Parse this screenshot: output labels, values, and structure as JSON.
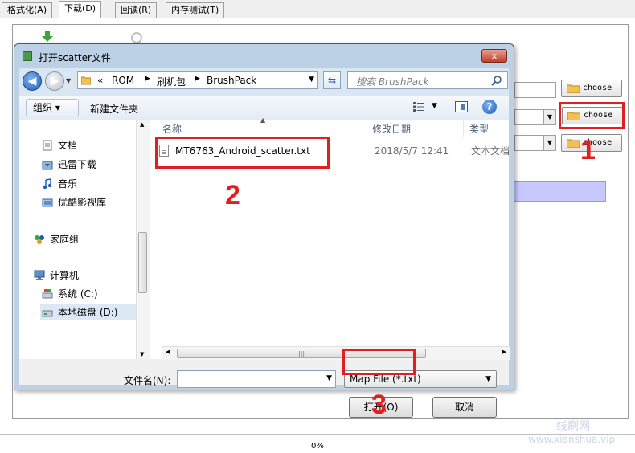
{
  "app": {
    "tabs": [
      {
        "label": "格式化(A)"
      },
      {
        "label": "下载(D)"
      },
      {
        "label": "回读(R)"
      },
      {
        "label": "内存测试(T)"
      }
    ],
    "choose_labels": [
      "choose",
      "choose",
      "choose"
    ],
    "progress_text": "0%",
    "watermark_cn": "线刷网",
    "watermark_url": "www.xianshua.vip"
  },
  "dialog": {
    "title": "打开scatter文件",
    "close_label": "x",
    "nav": {
      "breadcrumb_prefix": "«",
      "breadcrumb": [
        "ROM",
        "刷机包",
        "BrushPack"
      ],
      "search_placeholder": "搜索 BrushPack"
    },
    "toolbar": {
      "organize_label": "组织 ▾",
      "new_folder_label": "新建文件夹"
    },
    "sidebar_items": [
      {
        "label": "文档",
        "icon": "documents-icon"
      },
      {
        "label": "迅雷下载",
        "icon": "download-folder-icon"
      },
      {
        "label": "音乐",
        "icon": "music-icon"
      },
      {
        "label": "优酷影视库",
        "icon": "video-library-icon"
      },
      {
        "label": "家庭组",
        "icon": "homegroup-icon"
      },
      {
        "label": "计算机",
        "icon": "computer-icon"
      },
      {
        "label": "系统 (C:)",
        "icon": "drive-c-icon"
      },
      {
        "label": "本地磁盘 (D:)",
        "icon": "drive-d-icon"
      }
    ],
    "columns": {
      "name": "名称",
      "modified": "修改日期",
      "type": "类型"
    },
    "files": [
      {
        "name": "MT6763_Android_scatter.txt",
        "modified": "2018/5/7 12:41",
        "type": "文本文档"
      }
    ],
    "filename_label": "文件名(N):",
    "filename_value": "",
    "filter_value": "Map File (*.txt)",
    "open_label": "打开(O)",
    "cancel_label": "取消"
  },
  "annotations": {
    "step1": "1",
    "step2": "2",
    "step3": "3",
    "color": "#e02020"
  }
}
